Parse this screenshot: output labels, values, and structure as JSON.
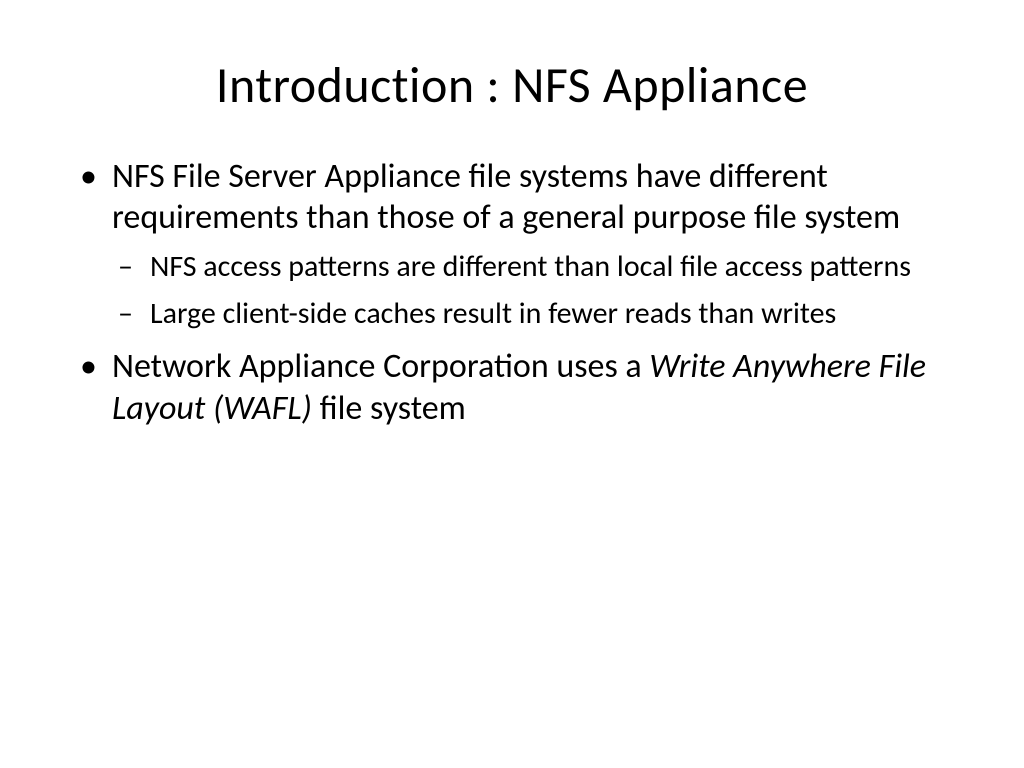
{
  "slide": {
    "title": "Introduction : NFS Appliance",
    "bullets": [
      {
        "text": "NFS File Server Appliance file systems have different requirements than those of a general purpose file system",
        "sub": [
          "NFS access patterns are different than local file access patterns",
          "Large client-side caches result in fewer reads than writes"
        ]
      },
      {
        "prefix": "Network Appliance Corporation uses a ",
        "italic": "Write Anywhere File Layout (WAFL)",
        "suffix": " file system"
      }
    ]
  }
}
